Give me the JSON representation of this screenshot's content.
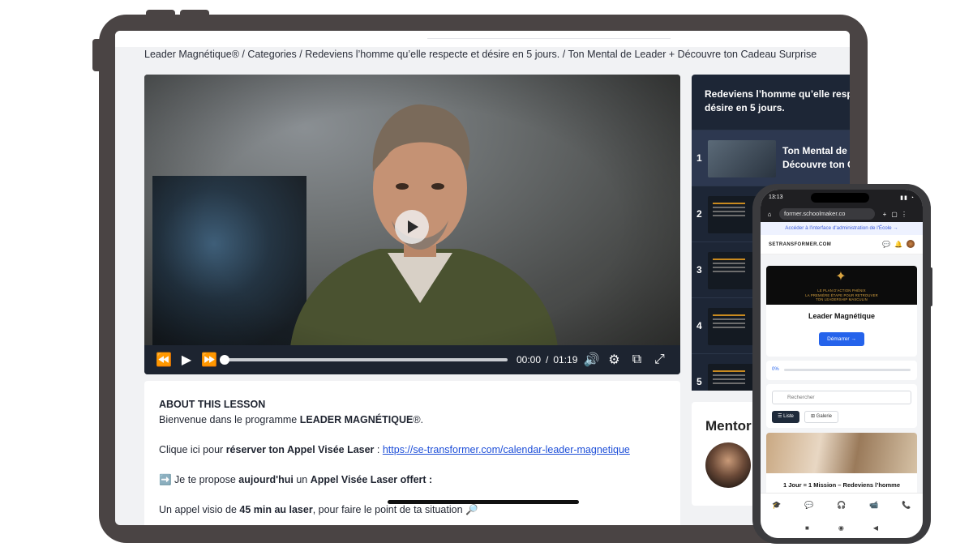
{
  "tablet": {
    "breadcrumb": "Leader Magnétique® / Categories / Redeviens l’homme qu’elle respecte et désire en 5 jours. / Ton Mental de Leader + Découvre ton Cadeau Surprise",
    "player": {
      "current_time": "00:00",
      "separator": "/",
      "duration": "01:19",
      "progress": 0,
      "icons": [
        "rewind-icon",
        "play-icon",
        "fast-forward-icon",
        "volume-icon",
        "settings-icon",
        "popout-icon",
        "fullscreen-icon"
      ]
    },
    "about": {
      "heading": "ABOUT THIS LESSON",
      "welcome_prefix": "Bienvenue dans le programme ",
      "welcome_bold": "LEADER MAGNÉTIQUE",
      "welcome_suffix": "®.",
      "click_prefix": "Clique ici pour ",
      "click_bold": "réserver ton Appel Visée Laser",
      "click_sep": " : ",
      "link": "https://se-transformer.com/calendar-leader-magnetique",
      "arrow_emoji": "➡️",
      "propose_1": " Je te propose ",
      "propose_bold_1": "aujourd'hui",
      "propose_2": " un ",
      "propose_bold_2": "Appel Visée Laser offert :",
      "call_prefix": "Un appel visio de ",
      "call_bold": "45 min au laser",
      "call_suffix": ", pour faire le point de ta situation",
      "call_emoji": "🔎"
    },
    "sidebar": {
      "title_line1": "Redeviens l’homme qu’elle respe",
      "title_line2": "désire en 5 jours.",
      "lessons": [
        {
          "num": "1",
          "title_line1": "Ton Mental de L",
          "title_line2": "Découvre ton Ca"
        },
        {
          "num": "2",
          "title_line1": "",
          "title_line2": ""
        },
        {
          "num": "3",
          "title_line1": "",
          "title_line2": ""
        },
        {
          "num": "4",
          "title_line1": "",
          "title_line2": ""
        },
        {
          "num": "5",
          "title_line1": "",
          "title_line2": ""
        }
      ]
    },
    "mentor": {
      "title": "Mentor"
    }
  },
  "phone": {
    "status_time": "13:13",
    "url": "former.schoolmaker.co",
    "admin_link": "Accéder à l'interface d'administration de l'École →",
    "brand": "SETRANSFORMER.COM",
    "banner_line1": "LE PLAN D'ACTION PHÉNIX",
    "banner_line2": "LA PREMIÈRE ÉTAPE POUR RETROUVER",
    "banner_line3": "TON LEADERSHIP MASCULIN",
    "course_name": "Leader Magnétique",
    "start_button": "Démarrer →",
    "progress_label": "0%",
    "progress": 0,
    "search_placeholder": "Rechercher",
    "view_list": "Liste",
    "view_gallery": "Galerie",
    "lesson_title": "1 Jour = 1 Mission – Redeviens l’homme"
  }
}
